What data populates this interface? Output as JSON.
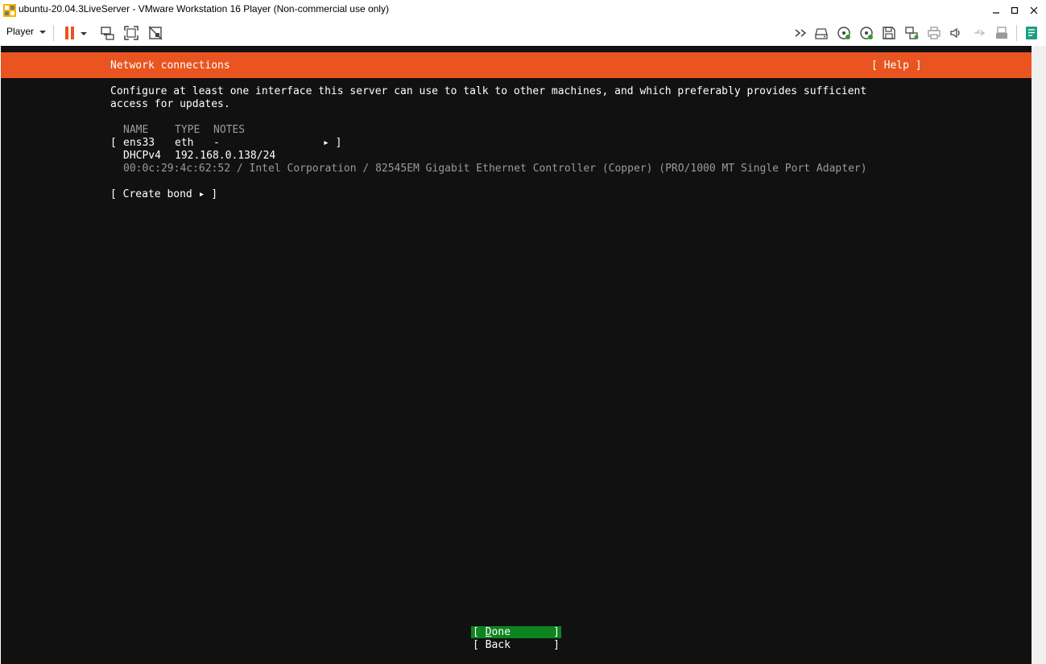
{
  "window": {
    "title": "ubuntu-20.04.3LiveServer - VMware Workstation 16 Player (Non-commercial use only)"
  },
  "toolbar": {
    "player_label": "Player",
    "icons": [
      "pause-icon",
      "send-ctrl-alt-del-icon",
      "fullscreen-icon",
      "unity-icon",
      "fast-forward-icon",
      "hard-disk-icon",
      "cd-dvd-icon",
      "cd-dvd-2-icon",
      "floppy-icon",
      "network-adapter-icon",
      "printer-icon",
      "sound-icon",
      "usb-icon",
      "removable-device-icon",
      "message-log-icon"
    ]
  },
  "installer": {
    "header_title": "Network connections",
    "help_label": "[ Help ]",
    "description_line1": "Configure at least one interface this server can use to talk to other machines, and which preferably provides sufficient",
    "description_line2": "access for updates.",
    "columns": {
      "name": "NAME",
      "type": "TYPE",
      "notes": "NOTES"
    },
    "interface": {
      "open_bracket": "[",
      "name": "ens33",
      "type": "eth",
      "notes": "-",
      "arrow": "▸ ]",
      "dhcp_label": "DHCPv4",
      "ip": "192.168.0.138/24",
      "hardware": "00:0c:29:4c:62:52 / Intel Corporation / 82545EM Gigabit Ethernet Controller (Copper) (PRO/1000 MT Single Port Adapter)"
    },
    "create_bond": "[ Create bond ▸ ]",
    "done_open": "[ ",
    "done_hotkey": "D",
    "done_rest": "one",
    "done_close": "]",
    "back_label": "[ Back",
    "back_close": "]"
  },
  "colors": {
    "ubuntu_orange": "#e95420",
    "terminal_bg": "#111111",
    "done_green": "#0e8420",
    "dim_text": "#9a9a9a",
    "pause_orange": "#e95420"
  }
}
